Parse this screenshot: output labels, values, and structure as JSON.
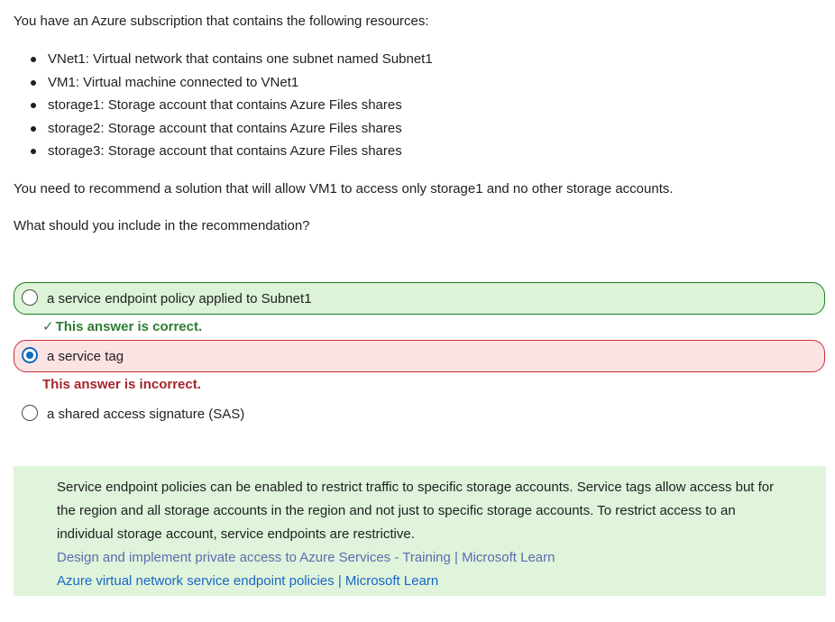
{
  "question": {
    "intro": "You have an Azure subscription that contains the following resources:",
    "resources": [
      "VNet1: Virtual network that contains one subnet named Subnet1",
      "VM1: Virtual machine connected to VNet1",
      "storage1: Storage account that contains Azure Files shares",
      "storage2: Storage account that contains Azure Files shares",
      "storage3: Storage account that contains Azure Files shares"
    ],
    "requirement": "You need to recommend a solution that will allow VM1 to access only storage1 and no other storage accounts.",
    "prompt": "What should you include in the recommendation?"
  },
  "options": [
    {
      "label": "a service endpoint policy applied to Subnet1",
      "selected": false,
      "status": "correct"
    },
    {
      "label": "a service tag",
      "selected": true,
      "status": "incorrect"
    },
    {
      "label": "a shared access signature (SAS)",
      "selected": false,
      "status": "none"
    }
  ],
  "feedback": {
    "correct": "This answer is correct.",
    "incorrect": "This answer is incorrect."
  },
  "explanation": {
    "text": "Service endpoint policies can be enabled to restrict traffic to specific storage accounts. Service tags allow access but for the region and all storage accounts in the region and not just to specific storage accounts. To restrict access to an individual storage account, service endpoints are restrictive.",
    "links": [
      "Design and implement private access to Azure Services - Training | Microsoft Learn",
      "Azure virtual network service endpoint policies | Microsoft Learn"
    ]
  },
  "colors": {
    "correct_border": "#1e7a1e",
    "correct_bg": "#dcf3d8",
    "incorrect_border": "#c4323c",
    "incorrect_bg": "#fbe2e3",
    "radio_selected": "#0f6cbd",
    "explanation_bg": "#dff4da"
  }
}
